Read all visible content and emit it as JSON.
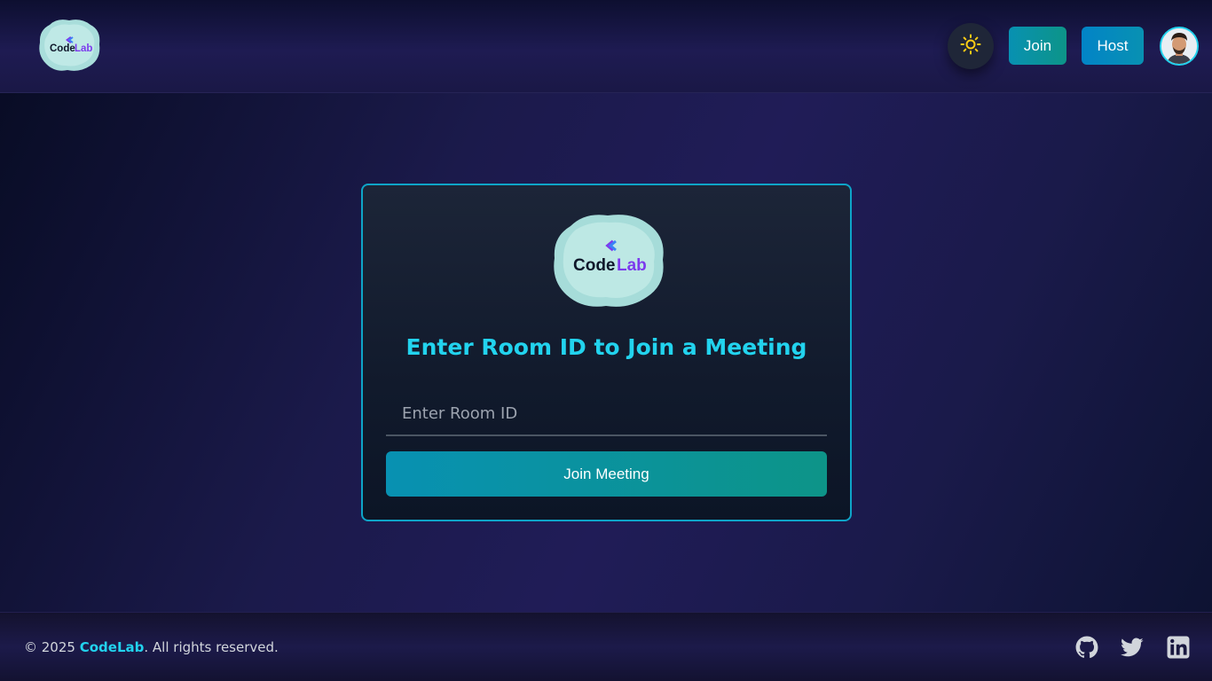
{
  "header": {
    "logo_text_code": "Code",
    "logo_text_lab": "Lab",
    "theme_icon": "sun-icon",
    "join_label": "Join",
    "host_label": "Host",
    "avatar_icon": "user-avatar"
  },
  "card": {
    "logo_text_code": "Code",
    "logo_text_lab": "Lab",
    "title": "Enter Room ID to Join a Meeting",
    "input_placeholder": "Enter Room ID",
    "input_value": "",
    "button_label": "Join Meeting"
  },
  "footer": {
    "copyright_prefix": "© 2025 ",
    "brand": "CodeLab",
    "copyright_suffix": ". All rights reserved.",
    "social_icons": [
      "github-icon",
      "twitter-icon",
      "linkedin-icon"
    ]
  },
  "colors": {
    "accent": "#22d3ee",
    "button_gradient_start": "#0891b2",
    "button_gradient_end": "#0d9488",
    "host_button": "#0284c7",
    "sun": "#facc15"
  }
}
